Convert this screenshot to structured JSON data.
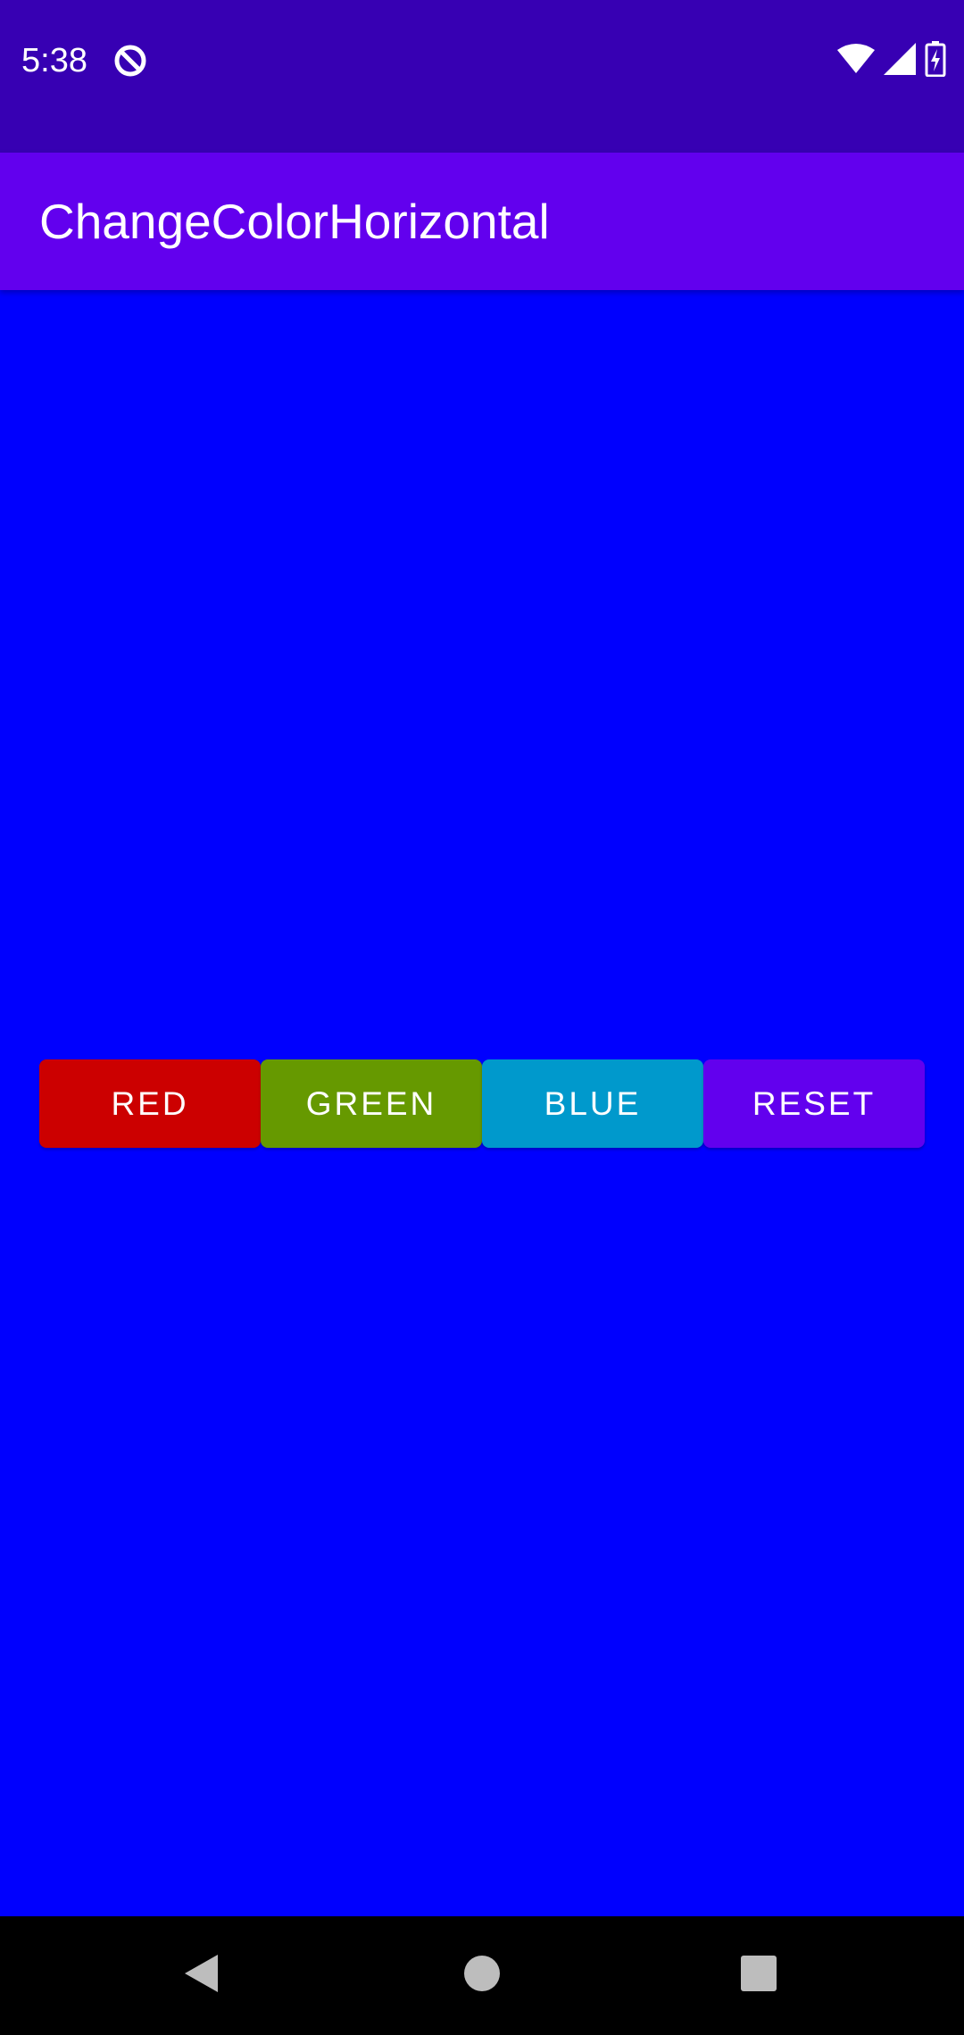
{
  "status_bar": {
    "time": "5:38",
    "icons": [
      "app-notification-icon",
      "wifi-icon",
      "cellular-signal-icon",
      "battery-charging-icon"
    ]
  },
  "app_bar": {
    "title": "ChangeColorHorizontal"
  },
  "main": {
    "background_color": "#0000FE",
    "buttons": [
      {
        "label": "RED",
        "color": "#CC0000"
      },
      {
        "label": "GREEN",
        "color": "#669900"
      },
      {
        "label": "BLUE",
        "color": "#0099CC"
      },
      {
        "label": "RESET",
        "color": "#6200EE"
      }
    ]
  },
  "nav_bar": {
    "icons": [
      "back-icon",
      "home-icon",
      "recents-icon"
    ]
  },
  "colors": {
    "status_bar": "#3700B3",
    "app_bar": "#6200EE",
    "nav_bar": "#000000"
  }
}
